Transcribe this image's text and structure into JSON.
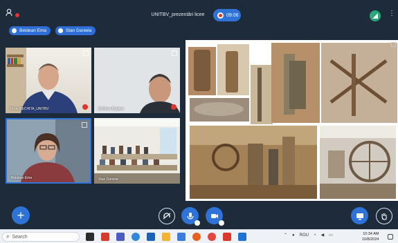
{
  "topbar": {
    "meeting_title": "UNITBV_prezentări licee",
    "recording_time": "09:06",
    "user_list_icon": "users-icon",
    "connection_icon": "signal-icon",
    "options_icon": "kebab-icon"
  },
  "talking": [
    "Beldean Ema",
    "Stan Daniela"
  ],
  "tiles": [
    {
      "name": "Florin NECHITA_UNITBV"
    },
    {
      "name": "Beldean Bogdan"
    },
    {
      "name": "Beldean Ema"
    },
    {
      "name": "Stan Daniela"
    }
  ],
  "controls": {
    "actions_icon": "plus-icon",
    "leave_audio_icon": "headset-icon",
    "mic_icon": "microphone-icon",
    "camera_icon": "camera-icon",
    "presentation_icon": "screen-icon",
    "raise_hand_icon": "hand-icon"
  },
  "taskbar": {
    "search_placeholder": "Search",
    "language": "ROU",
    "time": "10:34 AM",
    "date": "10/8/2024"
  },
  "colors": {
    "background": "#1d2b3b",
    "accent": "#2f73d8",
    "recording": "#e0362f",
    "connection": "#2aa776"
  }
}
